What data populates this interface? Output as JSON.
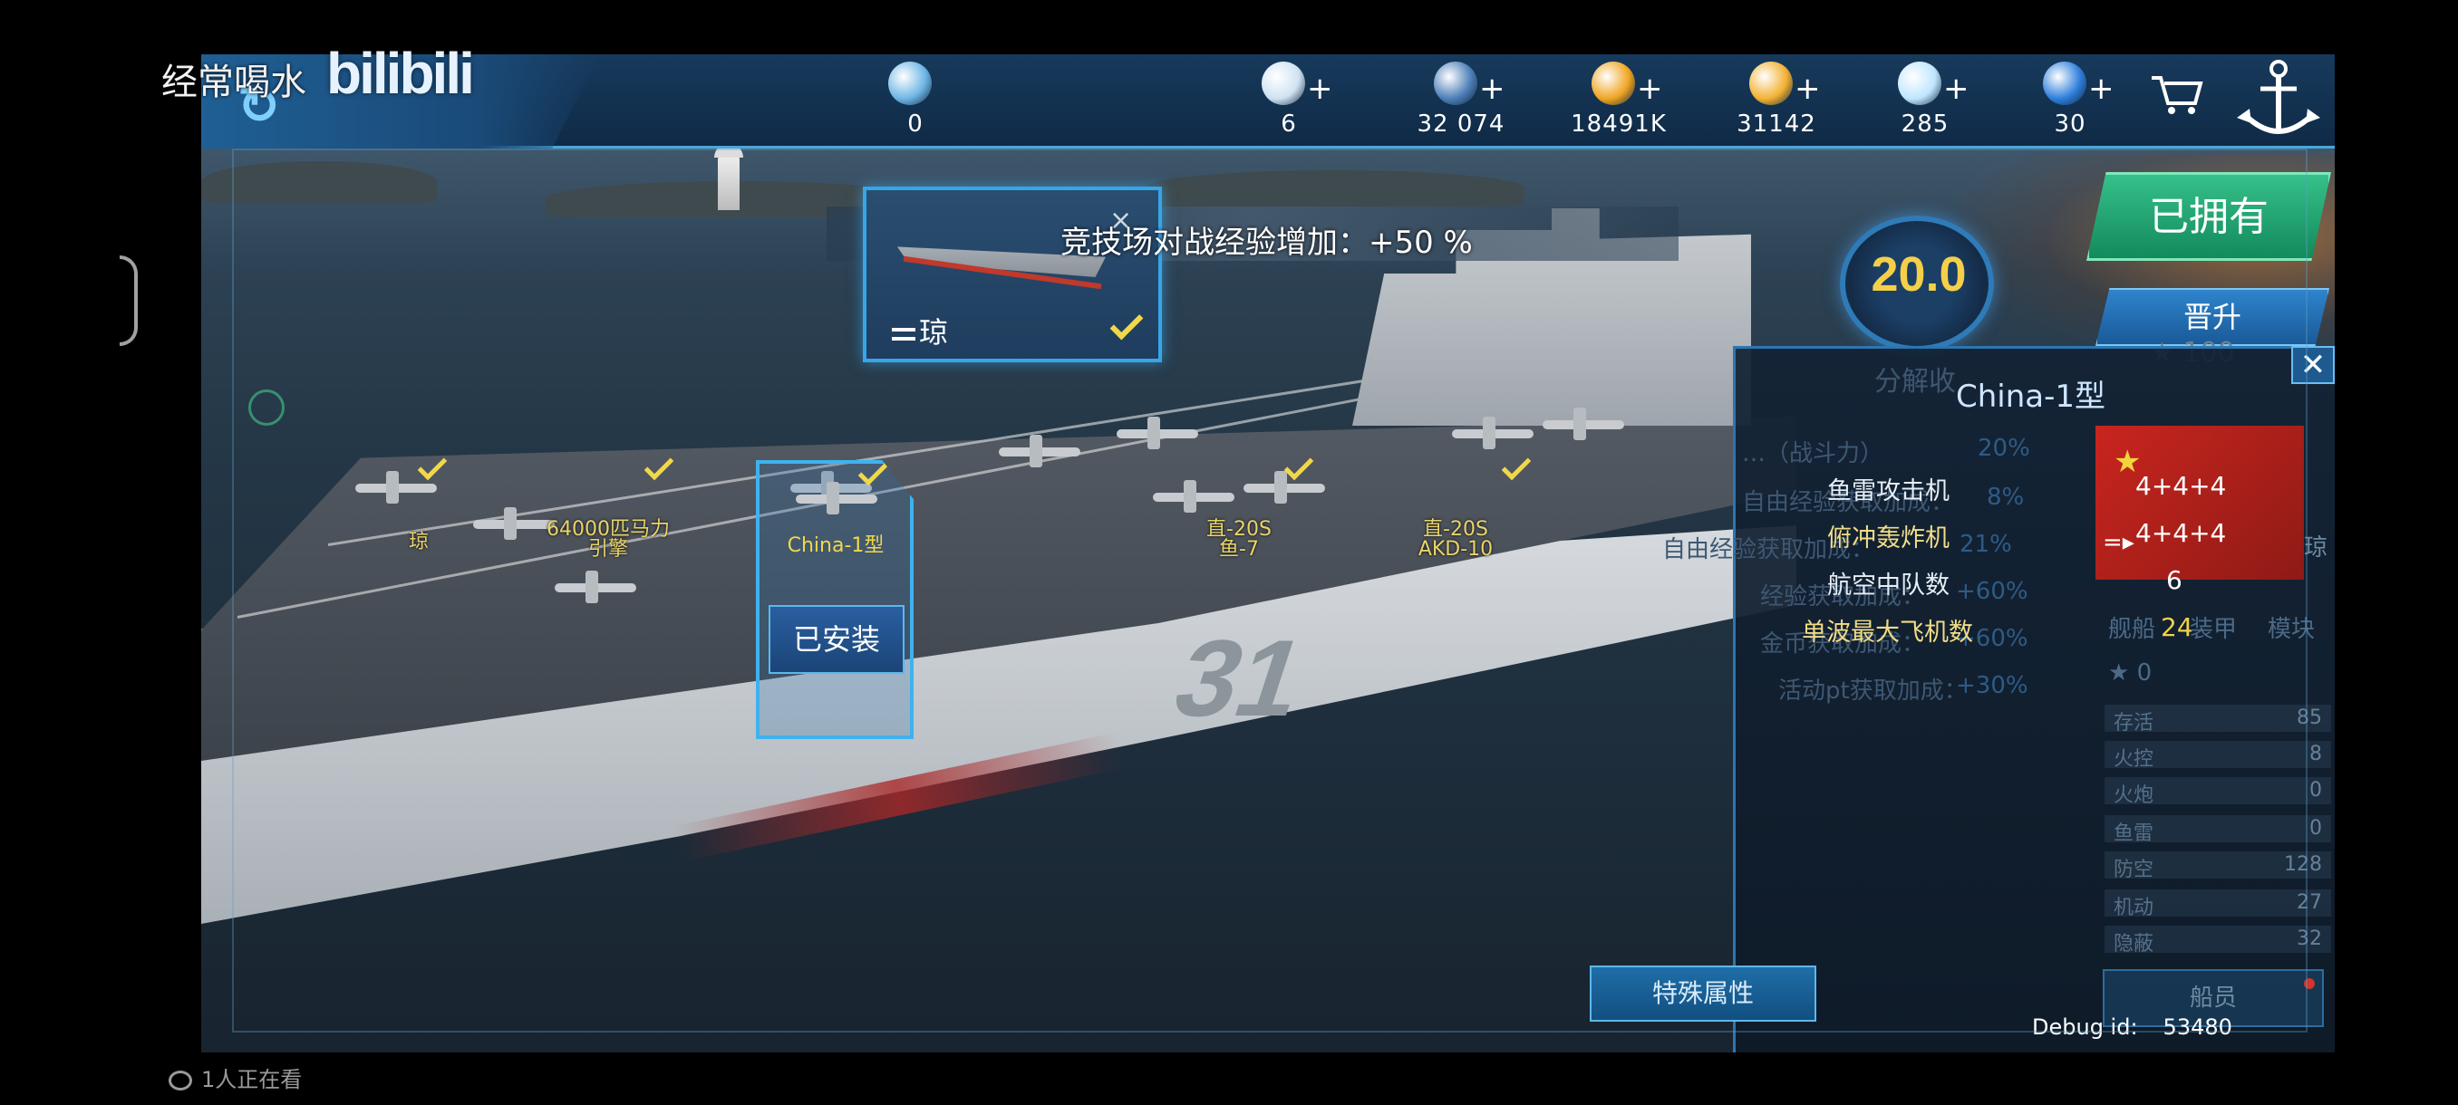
{
  "overlay": {
    "uploader": "经常喝水",
    "platform_logo": "bilibili",
    "viewers": "1人正在看"
  },
  "topbar": {
    "resources": [
      {
        "icon": "rank-badge-icon",
        "value": "0",
        "has_plus": false,
        "color": "#6fb6e6"
      },
      {
        "icon": "heart-icon",
        "value": "6",
        "has_plus": true,
        "color": "#cfe2f2"
      },
      {
        "icon": "card-icon",
        "value": "32 074",
        "has_plus": true,
        "color": "#4d7fb8"
      },
      {
        "icon": "gold-coin-icon",
        "value": "18491K",
        "has_plus": true,
        "color": "#f0a623"
      },
      {
        "icon": "star-icon",
        "value": "31142",
        "has_plus": true,
        "color": "#f3b233"
      },
      {
        "icon": "diamond-icon",
        "value": "285",
        "has_plus": true,
        "color": "#bfe6ff"
      },
      {
        "icon": "blue-gem-icon",
        "value": "30",
        "has_plus": true,
        "color": "#2f7fdc"
      }
    ],
    "plus_symbol": "+"
  },
  "arena_bonus": {
    "text": "竞技场对战经验增加：+50 %"
  },
  "selected_ship_card": {
    "name": "琼",
    "close": "×"
  },
  "deck": {
    "hull_number": "31",
    "labels": [
      {
        "text": "琼",
        "checked": true
      },
      {
        "text": "64000匹马力\n引擎",
        "checked": true
      },
      {
        "text": "China-1型",
        "checked": true
      },
      {
        "text": "直-20S\n鱼-7",
        "checked": true
      },
      {
        "text": "直-20S\nAKD-10",
        "checked": true
      }
    ],
    "install_button": "已安装"
  },
  "right_side": {
    "level": "20.0",
    "owned_badge": "已拥有",
    "promote_button": "晋升",
    "star_cost": "★ 100"
  },
  "detail_panel": {
    "ghost_title": "分解收",
    "title": "China-1型",
    "close": "✕",
    "flag_stars": "★",
    "ghost_lines": [
      {
        "label": "…（战斗力）",
        "value": "20%"
      },
      {
        "label": "自由经验获取加成：",
        "value": "8%"
      },
      {
        "label": "自由经验获取加成：",
        "value": "21%"
      },
      {
        "label": "经验获取加成：",
        "value": "+60%"
      },
      {
        "label": "金币获取加成：",
        "value": "+60%"
      },
      {
        "label": "活动pt获取加成：",
        "value": "+30%"
      }
    ],
    "attributes": [
      {
        "label": "鱼雷攻击机",
        "value": "4+4+4",
        "style": "white"
      },
      {
        "label": "俯冲轰炸机",
        "value": "4+4+4",
        "style": "gold"
      },
      {
        "label": "航空中队数",
        "value": "6",
        "style": "white"
      },
      {
        "label": "单波最大飞机数",
        "value": "24",
        "style": "gold"
      }
    ],
    "flag_tag": "=▸",
    "flag_name": "琼",
    "tabs": [
      "舰船",
      "装甲",
      "模块"
    ],
    "star_line": "★ 0",
    "stats": [
      {
        "label": "存活",
        "value": "85"
      },
      {
        "label": "火控",
        "value": "8"
      },
      {
        "label": "火炮",
        "value": "0"
      },
      {
        "label": "鱼雷",
        "value": "0"
      },
      {
        "label": "防空",
        "value": "128"
      },
      {
        "label": "机动",
        "value": "27"
      },
      {
        "label": "隐蔽",
        "value": "32"
      }
    ],
    "crew_button": "船员"
  },
  "special_button": "特殊属性",
  "debug": {
    "label": "Debug id:",
    "value": "53480"
  }
}
